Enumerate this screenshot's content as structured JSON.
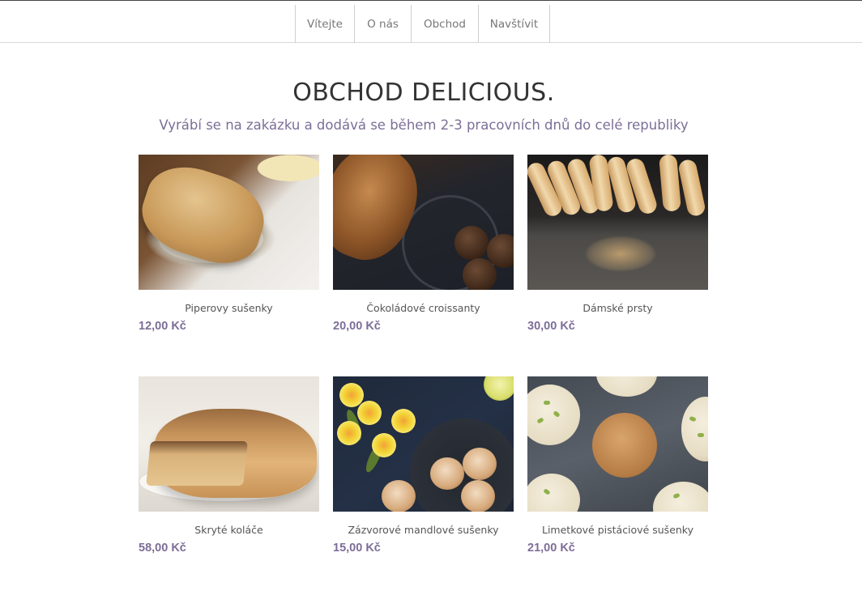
{
  "nav": {
    "items": [
      {
        "label": "Vítejte"
      },
      {
        "label": "O nás"
      },
      {
        "label": "Obchod"
      },
      {
        "label": "Navštívit"
      }
    ]
  },
  "header": {
    "title": "OBCHOD DELICIOUS.",
    "subtitle": "Vyrábí se na zakázku a dodává se během 2-3 pracovních dnů do celé republiky"
  },
  "products": [
    {
      "name": "Piperovy sušenky",
      "price": "12,00 Kč"
    },
    {
      "name": "Čokoládové croissanty",
      "price": "20,00 Kč"
    },
    {
      "name": "Dámské prsty",
      "price": "30,00 Kč"
    },
    {
      "name": "Skryté koláče",
      "price": "58,00 Kč"
    },
    {
      "name": "Zázvorové mandlové sušenky",
      "price": "15,00 Kč"
    },
    {
      "name": "Limetkové pistáciové sušenky",
      "price": "21,00 Kč"
    }
  ],
  "colors": {
    "accent": "#7c6e98",
    "title": "#333333",
    "nav_text": "#777777",
    "border": "#cfcfcf"
  }
}
